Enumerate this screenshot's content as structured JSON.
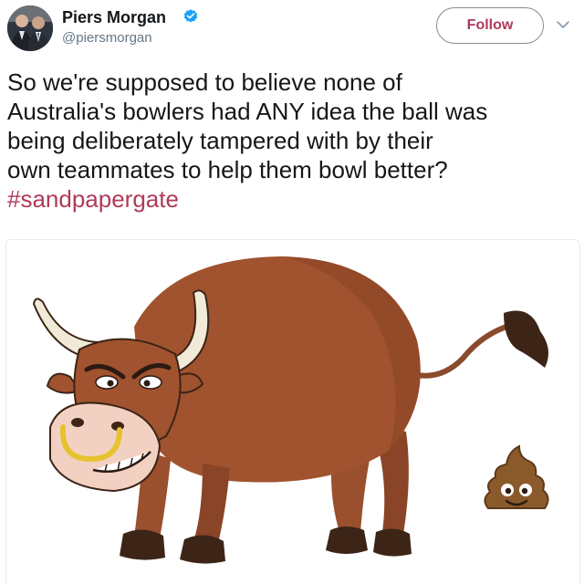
{
  "user": {
    "display_name": "Piers Morgan",
    "handle": "@piersmorgan",
    "verified": true,
    "avatar_icon": "avatar-photo"
  },
  "actions": {
    "follow_label": "Follow",
    "menu_icon": "chevron-down-icon"
  },
  "tweet": {
    "text_lines": [
      "So we're supposed to believe none of",
      "Australia's bowlers had ANY idea the ball was",
      "being deliberately tampered with by their",
      "own teammates to help them bowl better?"
    ],
    "hashtag": "#sandpapergate"
  },
  "media": {
    "image_icon": "cartoon-bull-with-nose-ring",
    "emoji_icon": "poop-emoji-icon"
  },
  "colors": {
    "accent": "#b03a5b",
    "text": "#14171a",
    "secondary_text": "#657786",
    "verified_blue": "#1da1f2"
  }
}
